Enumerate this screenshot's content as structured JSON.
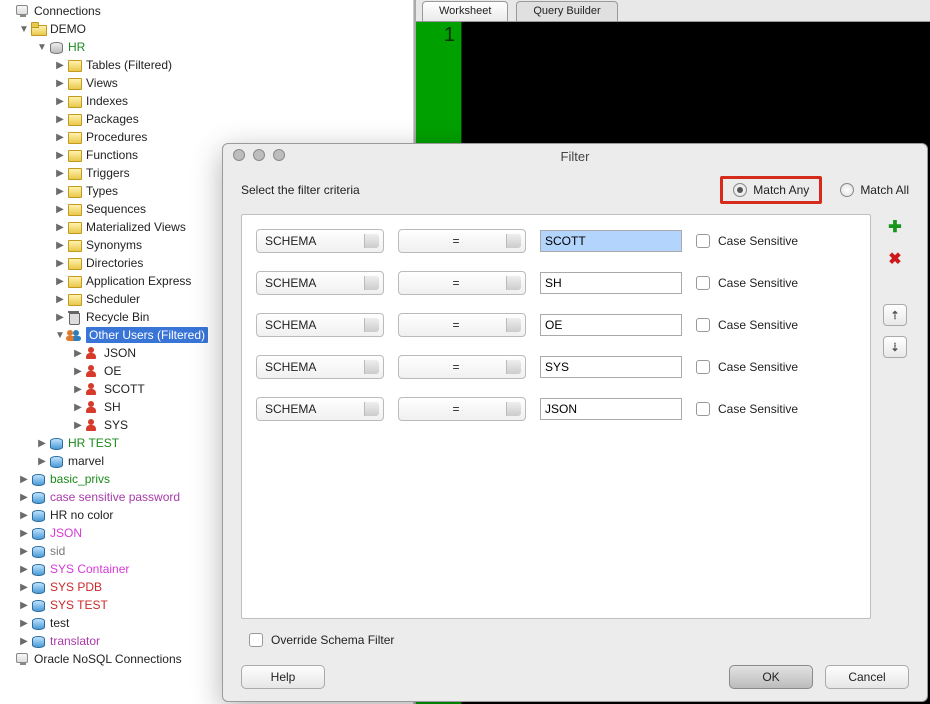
{
  "tree": {
    "root": "Connections",
    "demo": "DEMO",
    "hr": "HR",
    "hr_nodes": [
      "Tables (Filtered)",
      "Views",
      "Indexes",
      "Packages",
      "Procedures",
      "Functions",
      "Triggers",
      "Types",
      "Sequences",
      "Materialized Views",
      "Synonyms",
      "Directories",
      "Application Express",
      "Scheduler"
    ],
    "recycle": "Recycle Bin",
    "other_users": "Other Users (Filtered)",
    "users": [
      "JSON",
      "OE",
      "SCOTT",
      "SH",
      "SYS"
    ],
    "siblings_of_hr": [
      "HR TEST",
      "marvel"
    ],
    "connections": [
      {
        "label": "basic_privs",
        "cls": "green"
      },
      {
        "label": "case sensitive password",
        "cls": "purple"
      },
      {
        "label": "HR no color",
        "cls": ""
      },
      {
        "label": "JSON",
        "cls": "pink"
      },
      {
        "label": "sid",
        "cls": "gray"
      },
      {
        "label": "SYS Container",
        "cls": "pink"
      },
      {
        "label": "SYS PDB",
        "cls": "red"
      },
      {
        "label": "SYS TEST",
        "cls": "red"
      },
      {
        "label": "test",
        "cls": ""
      },
      {
        "label": "translator",
        "cls": "purple"
      }
    ],
    "nosql": "Oracle NoSQL Connections"
  },
  "editor": {
    "tab1": "Worksheet",
    "tab2": "Query Builder",
    "line1": "1"
  },
  "dialog": {
    "title": "Filter",
    "criteria_label": "Select the filter criteria",
    "match_any": "Match Any",
    "match_all": "Match All",
    "column_label": "SCHEMA",
    "op_label": "=",
    "case_label": "Case Sensitive",
    "rows": [
      {
        "value": "SCOTT",
        "selected": true
      },
      {
        "value": "SH",
        "selected": false
      },
      {
        "value": "OE",
        "selected": false
      },
      {
        "value": "SYS",
        "selected": false
      },
      {
        "value": "JSON",
        "selected": false
      }
    ],
    "override": "Override Schema Filter",
    "help": "Help",
    "ok": "OK",
    "cancel": "Cancel",
    "move_up": "⇡",
    "move_down": "⇣"
  }
}
